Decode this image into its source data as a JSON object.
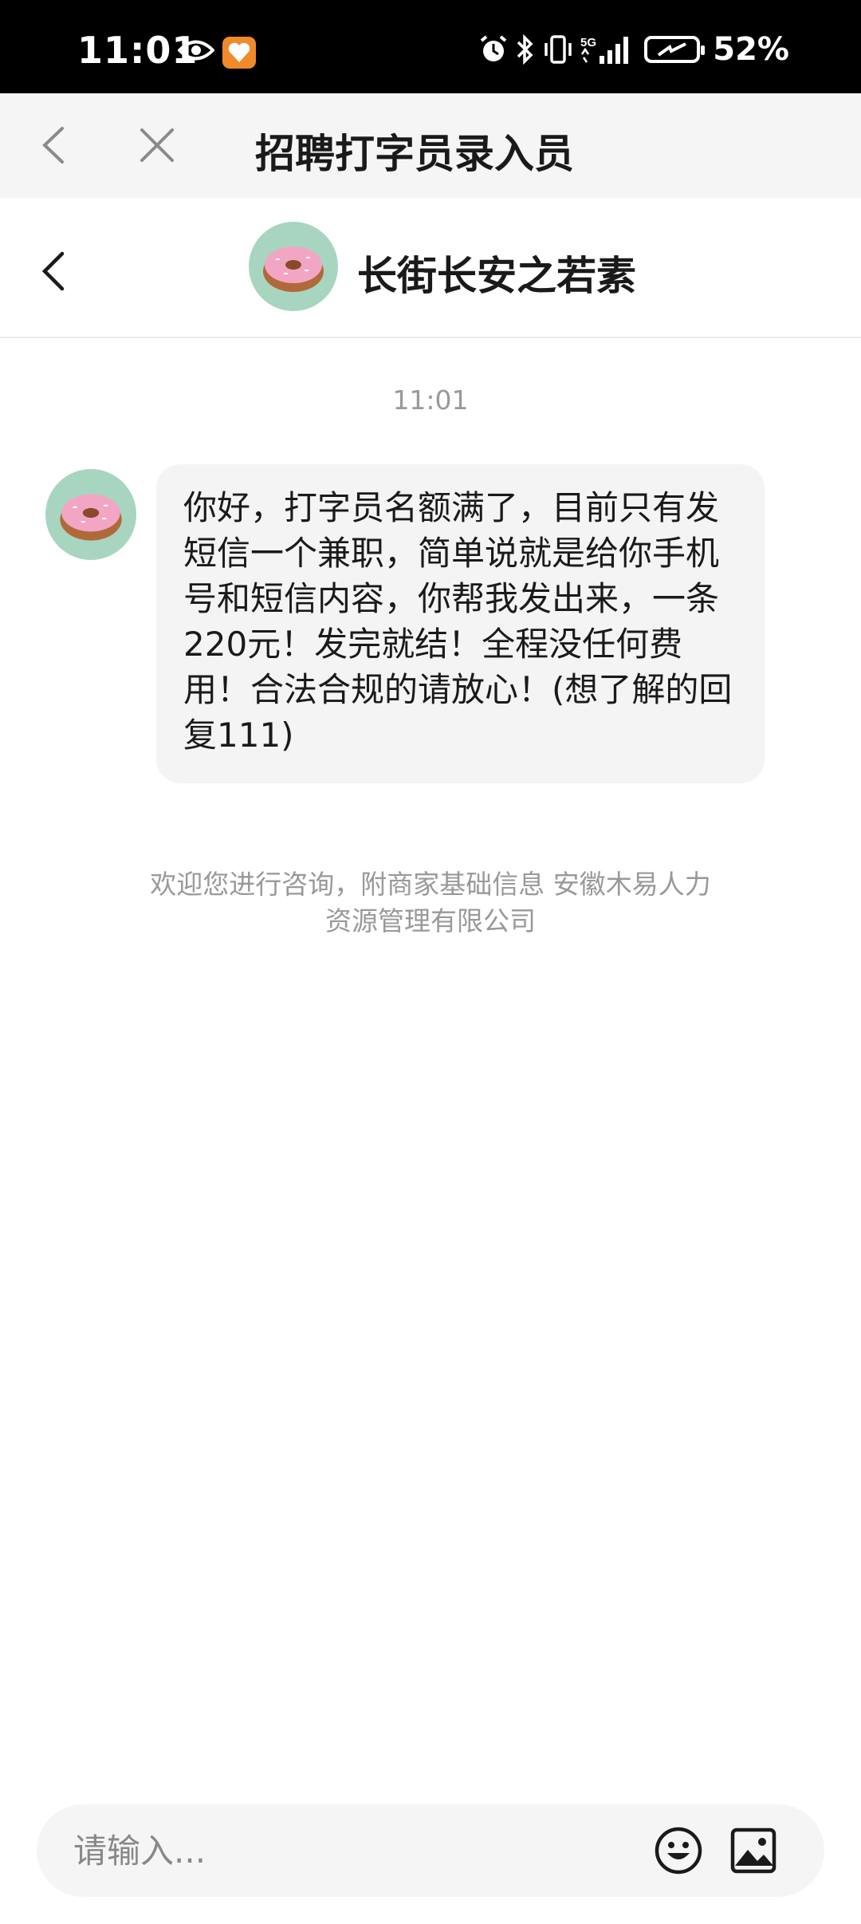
{
  "status_bar": {
    "time": "11:01",
    "network": "5G",
    "battery_percent": "52%",
    "icons": [
      "eye-icon",
      "app-notification-icon",
      "alarm-icon",
      "bluetooth-icon",
      "vibrate-icon",
      "signal-icon",
      "battery-icon"
    ]
  },
  "browser": {
    "title": "招聘打字员录入员",
    "icons": [
      "back-arrow-icon",
      "close-icon"
    ]
  },
  "chat": {
    "contact_name": "长街长安之若素",
    "avatar_icon": "donut-avatar-icon",
    "messages": [
      {
        "time": "11:01",
        "text": "你好，打字员名额满了，目前只有发短信一个兼职，简单说就是给你手机号和短信内容，你帮我发出来，一条220元！发完就结！全程没任何费用！合法合规的请放心！(想了解的回复111)"
      }
    ],
    "system_note": "欢迎您进行咨询，附商家基础信息 安徽木易人力资源管理有限公司"
  },
  "input": {
    "placeholder": "请输入...",
    "icons": [
      "emoji-icon",
      "image-icon"
    ]
  },
  "colors": {
    "status_bar_bg": "#000000",
    "browser_bar_bg": "#f5f5f5",
    "bubble_bg": "#f4f4f4",
    "avatar_bg": "#a8d5c0",
    "donut_icing": "#f3a6c4"
  }
}
